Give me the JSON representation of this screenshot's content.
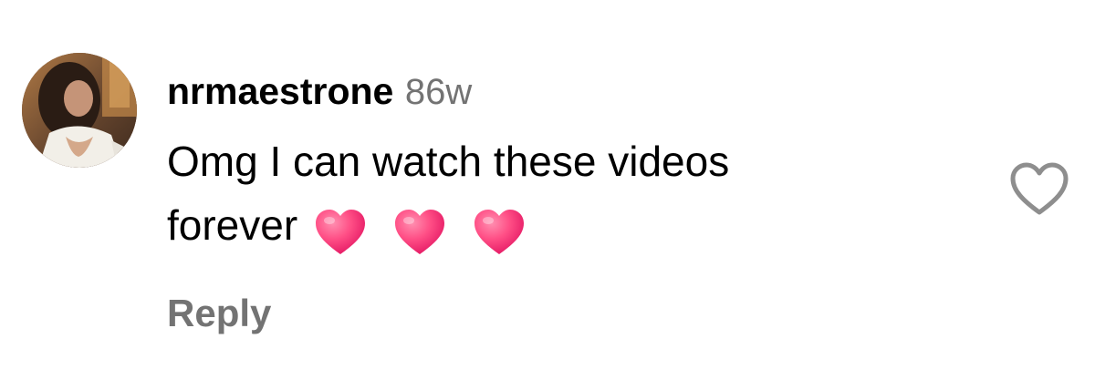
{
  "comment": {
    "username": "nrmaestrone",
    "timestamp": "86w",
    "text_line1": "Omg I can watch these videos",
    "text_line2": "forever",
    "emojis": [
      "heart-emoji",
      "heart-emoji",
      "heart-emoji"
    ],
    "reply_label": "Reply",
    "like_icon": "heart-outline-icon"
  },
  "colors": {
    "text_primary": "#000000",
    "text_secondary": "#737373",
    "heart_emoji_top": "#ff5b8a",
    "heart_emoji_bottom": "#e8146a",
    "like_icon_stroke": "#8e8e8e",
    "background": "#ffffff"
  }
}
